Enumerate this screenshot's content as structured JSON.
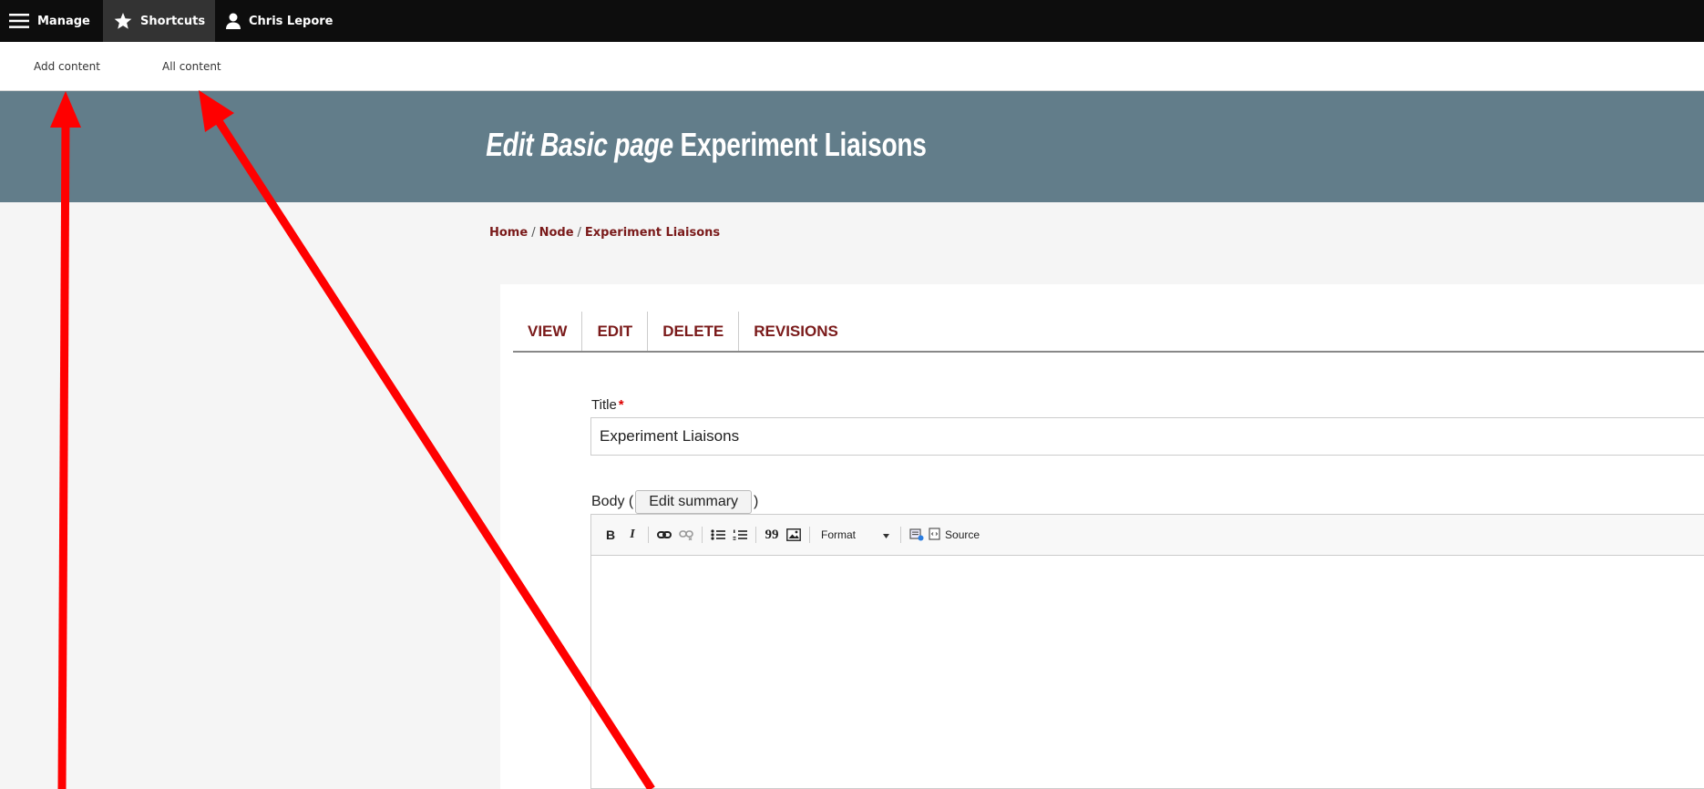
{
  "toolbar": {
    "manage_label": "Manage",
    "shortcuts_label": "Shortcuts",
    "user_label": "Chris Lepore"
  },
  "tray": {
    "links": [
      "Add content",
      "All content"
    ]
  },
  "page": {
    "title_italic": "Edit Basic page",
    "title_name": "Experiment Liaisons"
  },
  "breadcrumb": [
    "Home",
    "Node",
    "Experiment Liaisons"
  ],
  "tabs": [
    "VIEW",
    "EDIT",
    "DELETE",
    "REVISIONS"
  ],
  "form": {
    "title_label": "Title",
    "required_mark": "*",
    "title_value": "Experiment Liaisons",
    "body_label_open": "Body (",
    "edit_summary_label": "Edit summary",
    "body_label_close": ")"
  },
  "editor_toolbar": {
    "bold": "B",
    "italic": "I",
    "blockquote": "99",
    "format_label": "Format",
    "source_label": "Source"
  },
  "colors": {
    "toolbar_bg": "#0d0d0d",
    "header_band": "#627d8a",
    "link_accent": "#7a1a1a",
    "annotation_arrow": "#ff0000"
  }
}
